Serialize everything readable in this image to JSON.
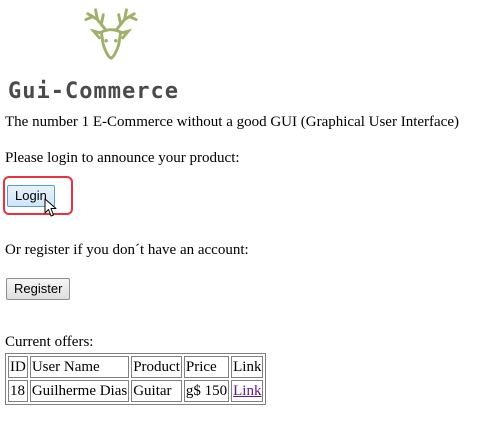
{
  "brand": {
    "logo_text": "Gui-Commerce",
    "logo_icon": "deer-head-icon",
    "logo_color": "#9fb06a"
  },
  "tagline": "The number 1 E-Commerce without a good GUI (Graphical User Interface)",
  "login": {
    "prompt": "Please login to announce your product:",
    "button_label": "Login",
    "highlight_color": "#e8333f"
  },
  "register": {
    "prompt": "Or register if you don´t have an account:",
    "button_label": "Register"
  },
  "offers": {
    "title": "Current offers:",
    "columns": [
      "ID",
      "User Name",
      "Product",
      "Price",
      "Link"
    ],
    "rows": [
      {
        "id": "18",
        "user_name": "Guilherme Dias",
        "product": "Guitar",
        "price": "g$ 150",
        "link": "Link"
      }
    ]
  }
}
